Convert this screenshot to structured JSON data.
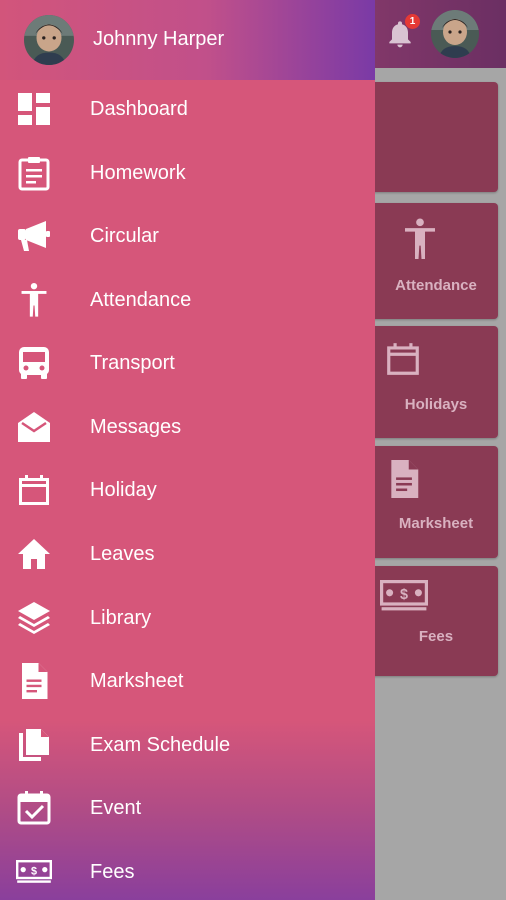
{
  "header": {
    "notification_count": "1"
  },
  "drawer": {
    "user_name": "Johnny Harper",
    "menu": [
      {
        "label": "Dashboard",
        "icon": "dashboard-icon"
      },
      {
        "label": "Homework",
        "icon": "clipboard-icon"
      },
      {
        "label": "Circular",
        "icon": "megaphone-icon"
      },
      {
        "label": "Attendance",
        "icon": "person-icon"
      },
      {
        "label": "Transport",
        "icon": "bus-icon"
      },
      {
        "label": "Messages",
        "icon": "envelope-icon"
      },
      {
        "label": "Holiday",
        "icon": "calendar-icon"
      },
      {
        "label": "Leaves",
        "icon": "home-icon"
      },
      {
        "label": "Library",
        "icon": "layers-icon"
      },
      {
        "label": "Marksheet",
        "icon": "document-icon"
      },
      {
        "label": "Exam Schedule",
        "icon": "copy-icon"
      },
      {
        "label": "Event",
        "icon": "event-calendar-icon"
      },
      {
        "label": "Fees",
        "icon": "money-icon"
      }
    ]
  },
  "tiles": [
    {
      "label": ""
    },
    {
      "label": "Attendance",
      "icon": "person-icon"
    },
    {
      "label": "Holidays",
      "icon": "calendar-icon"
    },
    {
      "label": "Marksheet",
      "icon": "document-icon"
    },
    {
      "label": "Fees",
      "icon": "money-icon"
    }
  ],
  "colors": {
    "drawer": "#d6567a",
    "header_start": "#c0507a",
    "header_end": "#6b2f63",
    "tile": "#8a3a54",
    "badge": "#e53935"
  }
}
